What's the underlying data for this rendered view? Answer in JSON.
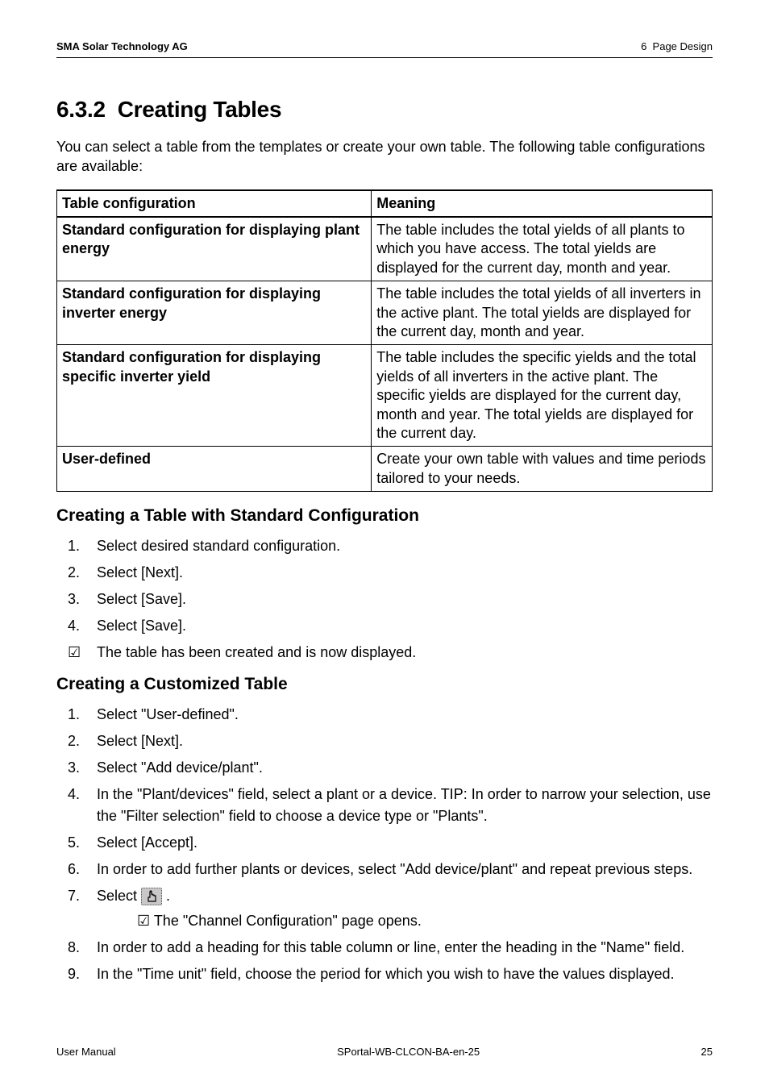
{
  "header": {
    "company": "SMA Solar Technology AG",
    "section": "6  Page Design"
  },
  "title": "6.3.2  Creating Tables",
  "intro": "You can select a table from the templates or create your own table. The following table configurations are available:",
  "table": {
    "head": {
      "col1": "Table configuration",
      "col2": "Meaning"
    },
    "rows": [
      {
        "c1": "Standard configuration for displaying plant energy",
        "c2": "The table includes the total yields of all plants to which you have access. The total yields are displayed for the current day, month and year."
      },
      {
        "c1": "Standard configuration for displaying inverter energy",
        "c2": "The table includes the total yields of all inverters in the active plant. The total yields are displayed for the current day, month and year."
      },
      {
        "c1": "Standard configuration for displaying specific inverter yield",
        "c2": "The table includes the specific yields and the total yields of all inverters in the active plant. The specific yields are displayed for the current day, month and year. The total yields are displayed for the current day."
      },
      {
        "c1": "User-defined",
        "c2": "Create your own table with values and time periods tailored to your needs."
      }
    ]
  },
  "sectionA": {
    "heading": "Creating a Table with Standard Configuration",
    "steps": [
      "Select desired standard configuration.",
      "Select [Next].",
      "Select [Save].",
      "Select [Save]."
    ],
    "result": "The table has been created and is now displayed."
  },
  "sectionB": {
    "heading": "Creating a Customized Table",
    "steps": {
      "s1": "Select \"User-defined\".",
      "s2": "Select [Next].",
      "s3": "Select \"Add device/plant\".",
      "s4": "In the \"Plant/devices\" field, select a plant or a device. TIP: In order to narrow your selection, use the \"Filter selection\" field to choose a device type or \"Plants\".",
      "s5": "Select [Accept].",
      "s6": "In order to add further plants or devices, select \"Add device/plant\" and repeat previous steps.",
      "s7a": "Select ",
      "s7b": " .",
      "s7result": "The \"Channel Configuration\" page opens.",
      "s8": "In order to add a heading for this table column or line, enter the heading in the \"Name\" field.",
      "s9": "In the \"Time unit\" field, choose the period for which you wish to have the values displayed."
    }
  },
  "footer": {
    "left": "User Manual",
    "center": "SPortal-WB-CLCON-BA-en-25",
    "right": "25"
  }
}
